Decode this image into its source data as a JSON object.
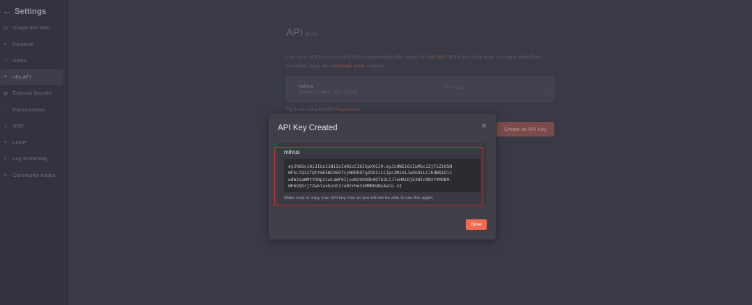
{
  "sidebar": {
    "title": "Settings",
    "back_icon": "arrow-left-icon",
    "items": [
      {
        "label": "Usage and plan",
        "icon": "chart-icon",
        "glyph": "▤"
      },
      {
        "label": "Personal",
        "icon": "user-circle-icon",
        "glyph": "●"
      },
      {
        "label": "Users",
        "icon": "users-icon",
        "glyph": "⚇"
      },
      {
        "label": "n8n API",
        "icon": "plug-icon",
        "glyph": "✦",
        "active": true
      },
      {
        "label": "External Secrets",
        "icon": "vault-icon",
        "glyph": "▣"
      },
      {
        "label": "Environments",
        "icon": "branch-icon",
        "glyph": "⑂"
      },
      {
        "label": "SSO",
        "icon": "key-icon",
        "glyph": "⚷"
      },
      {
        "label": "LDAP",
        "icon": "user-lock-icon",
        "glyph": "●"
      },
      {
        "label": "Log Streaming",
        "icon": "sync-icon",
        "glyph": "↻"
      },
      {
        "label": "Community nodes",
        "icon": "cube-icon",
        "glyph": "◈"
      }
    ]
  },
  "page": {
    "title": "API",
    "beta": "(beta)",
    "desc_part1": "Use your API Key to control n8n programmatically using the ",
    "desc_link1": "n8n API",
    "desc_part2": ". But if you only want to trigger workflows, consider using the ",
    "desc_link2": "webhook node",
    "desc_part3": " instead.",
    "key_card": {
      "name": "milvus",
      "expiry": "Expires on Wed, Sep 10 2025",
      "masked_key": "******p1k"
    },
    "playground_prefix": "Try it out using the ",
    "playground_link": "API Playground",
    "create_button": "Create an API Key"
  },
  "modal": {
    "title": "API Key Created",
    "key_name": "milvus",
    "token_lines": [
      "eyJhbGciOiJIUzI1NiIsInR5cCI6IkpXVCJ9.eyJzdWIiOiIwMzc1ZjFiZi05N",
      "WFkLTQ1ZTQtYmE5NC05OTcyNDRhOTg2OGIiLCJpc3MiOiJuOG4iLCJhdWQiOiJ",
      "wdWJsaWMtYXBpIiwiaWF0IjoxNzU0ODk0OTA3LCJleHAiOjE3NTc0NzY4MDB9.",
      "WPbVQhrjTZwklavhvUt2ru0YrHetkMMBhUNsAsCo-3I"
    ],
    "copy_note": "Make sure to copy your API key now as you will not be able to see this again.",
    "done_button": "Done",
    "close_icon": "close-icon",
    "highlight_color": "#d0312d"
  }
}
